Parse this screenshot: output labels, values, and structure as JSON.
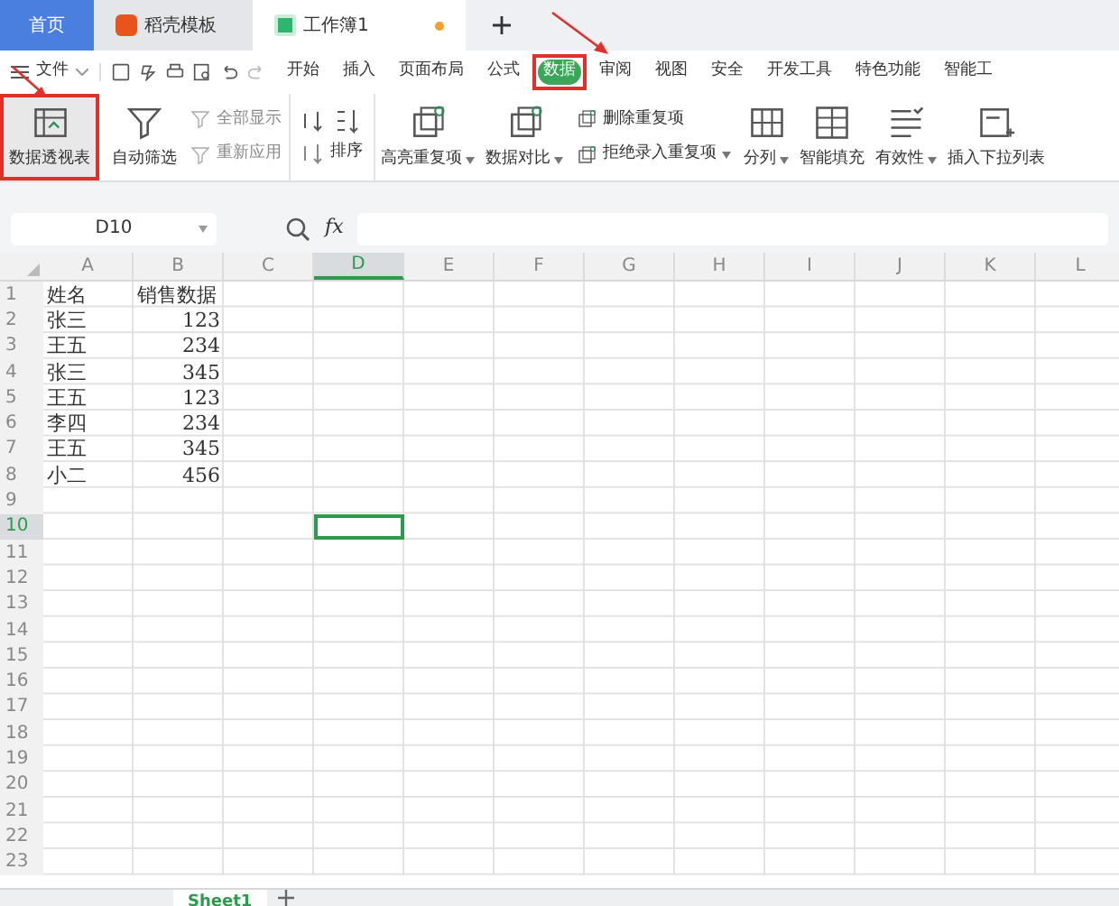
{
  "title_tabs": [
    {
      "label": "首页",
      "kind": "home",
      "selected": false
    },
    {
      "label": "稻壳模板",
      "kind": "docer",
      "selected": false
    },
    {
      "label": "工作簿1",
      "kind": "sheet",
      "selected": true
    }
  ],
  "menu": {
    "file": "文件",
    "items": [
      {
        "label": "开始",
        "selected": false,
        "highlighted": false
      },
      {
        "label": "插入",
        "selected": false,
        "highlighted": false
      },
      {
        "label": "页面布局",
        "selected": false,
        "highlighted": false
      },
      {
        "label": "公式",
        "selected": false,
        "highlighted": false
      },
      {
        "label": "数据",
        "selected": true,
        "highlighted": true
      },
      {
        "label": "审阅",
        "selected": false,
        "highlighted": false
      },
      {
        "label": "视图",
        "selected": false,
        "highlighted": false
      },
      {
        "label": "安全",
        "selected": false,
        "highlighted": false
      },
      {
        "label": "开发工具",
        "selected": false,
        "highlighted": false
      },
      {
        "label": "特色功能",
        "selected": false,
        "highlighted": false
      },
      {
        "label": "智能工",
        "selected": false,
        "highlighted": false
      }
    ]
  },
  "toolbar": [
    {
      "kind": "big",
      "label": "数据透视表",
      "dropdown": false,
      "highlighted": true
    },
    {
      "kind": "big",
      "label": "自动筛选",
      "dropdown": false,
      "highlighted": false
    },
    {
      "kind": "stack",
      "items": [
        {
          "label": "全部显示",
          "disabled": true,
          "dropdown": false
        },
        {
          "label": "重新应用",
          "disabled": true,
          "dropdown": false
        }
      ]
    },
    {
      "kind": "sort",
      "label": "排序"
    },
    {
      "kind": "big",
      "label": "高亮重复项",
      "dropdown": true,
      "highlighted": false
    },
    {
      "kind": "big",
      "label": "数据对比",
      "dropdown": true,
      "highlighted": false
    },
    {
      "kind": "stack",
      "items": [
        {
          "label": "删除重复项",
          "disabled": false,
          "dropdown": false
        },
        {
          "label": "拒绝录入重复项",
          "disabled": false,
          "dropdown": true
        }
      ]
    },
    {
      "kind": "big",
      "label": "分列",
      "dropdown": true,
      "highlighted": false
    },
    {
      "kind": "big",
      "label": "智能填充",
      "dropdown": false,
      "highlighted": false
    },
    {
      "kind": "big",
      "label": "有效性",
      "dropdown": true,
      "highlighted": false
    },
    {
      "kind": "big",
      "label": "插入下拉列表",
      "dropdown": false,
      "highlighted": false
    }
  ],
  "name_box": "D10",
  "fx": "fx",
  "columns": [
    {
      "label": "A",
      "selected": false
    },
    {
      "label": "B",
      "selected": false
    },
    {
      "label": "C",
      "selected": false
    },
    {
      "label": "D",
      "selected": true
    },
    {
      "label": "E",
      "selected": false
    },
    {
      "label": "F",
      "selected": false
    },
    {
      "label": "G",
      "selected": false
    },
    {
      "label": "H",
      "selected": false
    },
    {
      "label": "I",
      "selected": false
    },
    {
      "label": "J",
      "selected": false
    },
    {
      "label": "K",
      "selected": false
    },
    {
      "label": "L",
      "selected": false
    }
  ],
  "rows": [
    {
      "label": "1",
      "selected": false,
      "cells": [
        "姓名",
        "销售数据"
      ]
    },
    {
      "label": "2",
      "selected": false,
      "cells": [
        "张三",
        "123"
      ]
    },
    {
      "label": "3",
      "selected": false,
      "cells": [
        "王五",
        "234"
      ]
    },
    {
      "label": "4",
      "selected": false,
      "cells": [
        "张三",
        "345"
      ]
    },
    {
      "label": "5",
      "selected": false,
      "cells": [
        "王五",
        "123"
      ]
    },
    {
      "label": "6",
      "selected": false,
      "cells": [
        "李四",
        "234"
      ]
    },
    {
      "label": "7",
      "selected": false,
      "cells": [
        "王五",
        "345"
      ]
    },
    {
      "label": "8",
      "selected": false,
      "cells": [
        "小二",
        "456"
      ]
    },
    {
      "label": "9",
      "selected": false,
      "cells": []
    },
    {
      "label": "10",
      "selected": true,
      "cells": []
    },
    {
      "label": "11",
      "selected": false,
      "cells": []
    },
    {
      "label": "12",
      "selected": false,
      "cells": []
    },
    {
      "label": "13",
      "selected": false,
      "cells": []
    },
    {
      "label": "14",
      "selected": false,
      "cells": []
    },
    {
      "label": "15",
      "selected": false,
      "cells": []
    },
    {
      "label": "16",
      "selected": false,
      "cells": []
    },
    {
      "label": "17",
      "selected": false,
      "cells": []
    },
    {
      "label": "18",
      "selected": false,
      "cells": []
    },
    {
      "label": "19",
      "selected": false,
      "cells": []
    },
    {
      "label": "20",
      "selected": false,
      "cells": []
    },
    {
      "label": "21",
      "selected": false,
      "cells": []
    },
    {
      "label": "22",
      "selected": false,
      "cells": []
    },
    {
      "label": "23",
      "selected": false,
      "cells": []
    }
  ],
  "sheet_tabs": [
    {
      "label": "Sheet1",
      "selected": true
    }
  ]
}
